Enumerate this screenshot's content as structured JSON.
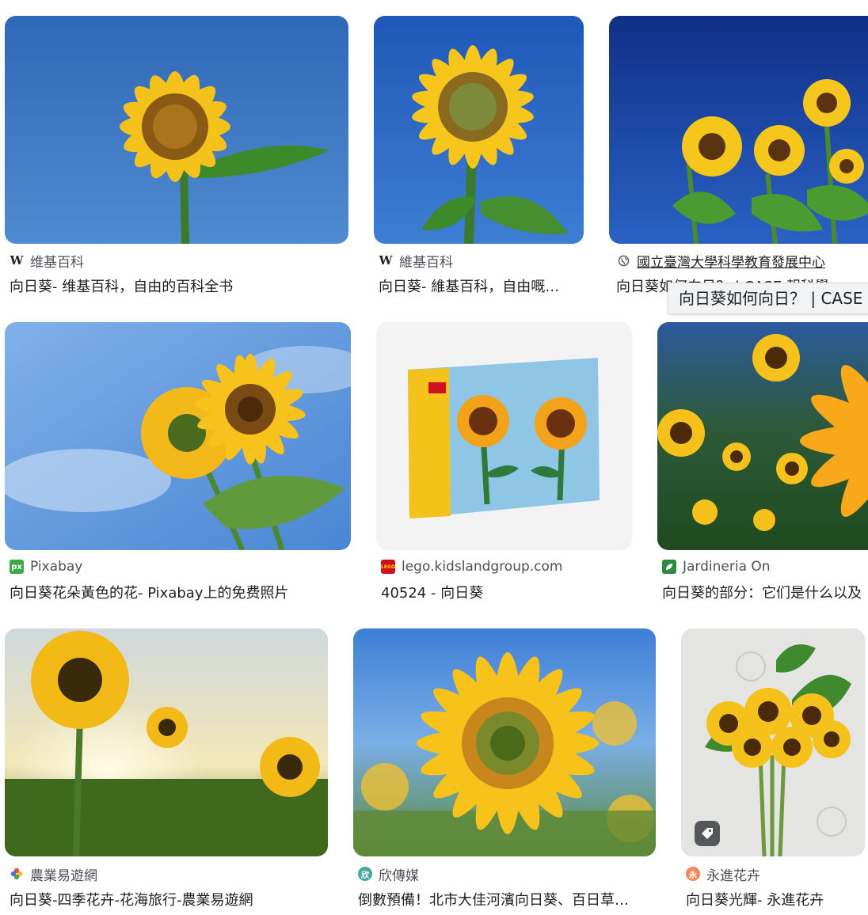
{
  "results": [
    {
      "source": "维基百科",
      "favicon": "W",
      "title": "向日葵- 维基百科，自由的百科全书"
    },
    {
      "source": "維基百科",
      "favicon": "W",
      "title": "向日葵- 維基百科，自由嘅…"
    },
    {
      "source": "國立臺灣大學科學教育發展中心",
      "favicon": "globe-icon",
      "title": "向日葵如何向日？ | CASE 報科學"
    },
    {
      "source": "Pixabay",
      "favicon": "px",
      "title": "向日葵花朵黃色的花- Pixabay上的免费照片"
    },
    {
      "source": "lego.kidslandgroup.com",
      "favicon": "LEGO",
      "title": "40524 - 向日葵"
    },
    {
      "source": "Jardineria On",
      "favicon": "leaf-icon",
      "title": "向日葵的部分：它们是什么以及"
    },
    {
      "source": "農業易遊網",
      "favicon": "flower-icon",
      "title": "向日葵-四季花卉-花海旅行-農業易遊網"
    },
    {
      "source": "欣傳媒",
      "favicon": "欣",
      "title": "倒數預備！北市大佳河濱向日葵、百日草…"
    },
    {
      "source": "永進花卉",
      "favicon": "永",
      "title": "向日葵光輝- 永進花卉"
    }
  ],
  "tooltip": "向日葵如何向日？ | CASE 報科學",
  "colors": {
    "sky": "#3f78c4",
    "petal": "#f5c518",
    "center": "#7a4a12",
    "leaf": "#3f8a2e"
  }
}
